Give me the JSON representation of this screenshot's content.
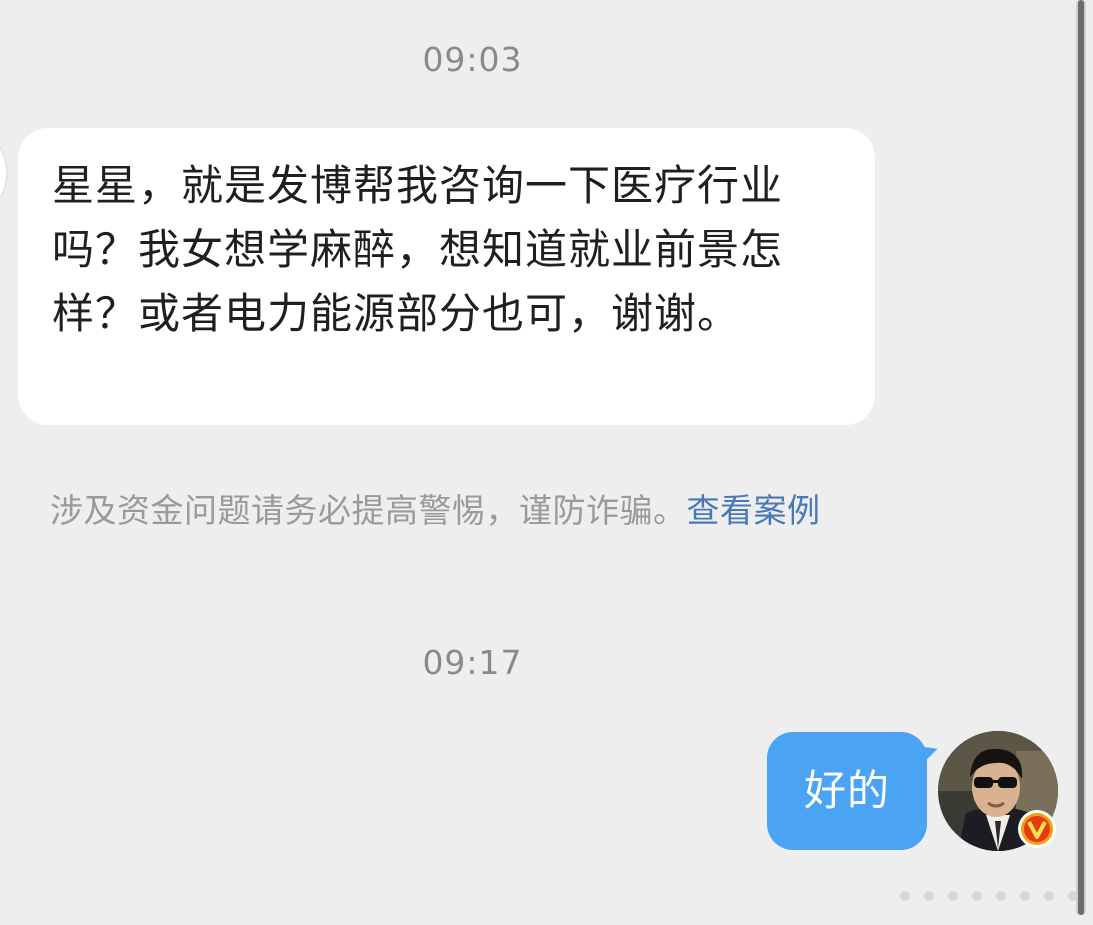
{
  "conversation": {
    "timestamp_1": "09:03",
    "incoming_message": "星星，就是发博帮我咨询一下医疗行业吗？我女想学麻醉，想知道就业前景怎样？或者电力能源部分也可，谢谢。",
    "warning_text": "涉及资金问题请务必提高警惕，谨防诈骗。",
    "warning_link": "查看案例",
    "timestamp_2": "09:17",
    "outgoing_message": "好的"
  },
  "icons": {
    "verified": "verified-v-badge-icon",
    "avatar": "user-avatar-sunglasses"
  },
  "colors": {
    "background": "#eeeeef",
    "outgoing_bubble": "#4ba3f4",
    "link": "#4a78b6",
    "badge": "#f2a10c"
  }
}
